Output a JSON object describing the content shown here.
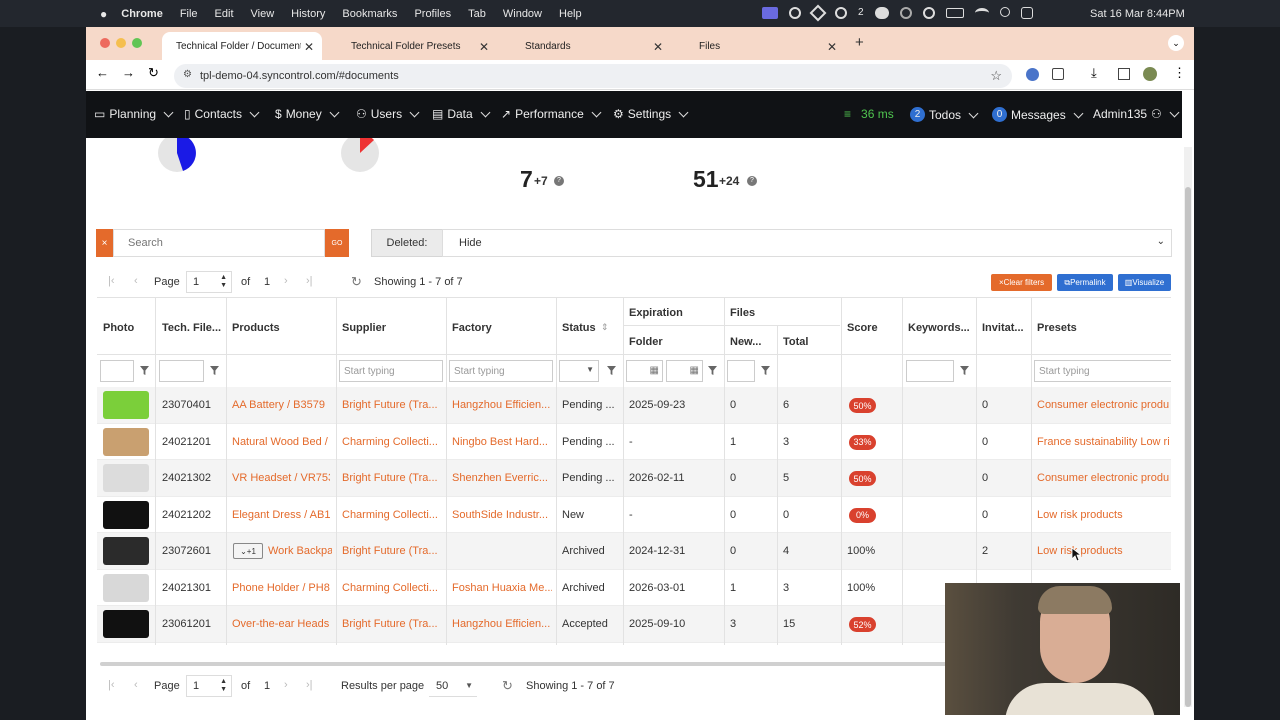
{
  "menubar": {
    "apple": "",
    "app": "Chrome",
    "items": [
      "File",
      "Edit",
      "View",
      "History",
      "Bookmarks",
      "Profiles",
      "Tab",
      "Window",
      "Help"
    ],
    "badge2": "2",
    "datetime": "Sat 16 Mar  8:44PM"
  },
  "tabs": [
    {
      "label": "Technical Folder / Documents"
    },
    {
      "label": "Technical Folder Presets"
    },
    {
      "label": "Standards"
    },
    {
      "label": "Files"
    }
  ],
  "address": {
    "url": "tpl-demo-04.syncontrol.com/#documents"
  },
  "nav": {
    "items": [
      "Planning",
      "Contacts",
      "Money",
      "Users",
      "Data",
      "Performance",
      "Settings"
    ],
    "latency": "36 ms",
    "todos_count": "2",
    "todos_label": "Todos",
    "messages_count": "0",
    "messages_label": "Messages",
    "user": "Admin135"
  },
  "stats": {
    "a_value": "7",
    "a_delta": "+7",
    "b_value": "51",
    "b_delta": "+24"
  },
  "search": {
    "placeholder": "Search",
    "clear": "×",
    "go": "GO"
  },
  "deleted": {
    "label": "Deleted:",
    "value": "Hide"
  },
  "pager_top": {
    "page_label": "Page",
    "page": "1",
    "of": "of",
    "total": "1",
    "showing": "Showing 1 - 7 of 7"
  },
  "actions": {
    "clear": "Clear filters",
    "permalink": "Permalink",
    "visualize": "Visualize"
  },
  "columns": {
    "photo": "Photo",
    "tech": "Tech. File...",
    "products": "Products",
    "supplier": "Supplier",
    "factory": "Factory",
    "status": "Status",
    "expiration": "Expiration",
    "folder": "Folder",
    "files": "Files",
    "new": "New...",
    "total": "Total",
    "score": "Score",
    "keywords": "Keywords...",
    "invit": "Invitat...",
    "presets": "Presets"
  },
  "filters": {
    "start_typing": "Start typing"
  },
  "rows": [
    {
      "tech": "23070401",
      "product": "AA Battery / B3579",
      "supplier": "Bright Future (Tra...",
      "factory": "Hangzhou Efficien...",
      "status": "Pending ...",
      "folder": "2025-09-23",
      "new": "0",
      "total": "6",
      "score": "50%",
      "score_badge": true,
      "invit": "0",
      "preset": "Consumer electronic produ",
      "photo": "battery-icon"
    },
    {
      "tech": "24021201",
      "product": "Natural Wood Bed /",
      "supplier": "Charming Collecti...",
      "factory": "Ningbo Best Hard...",
      "status": "Pending ...",
      "folder": "-",
      "new": "1",
      "total": "3",
      "score": "33%",
      "score_badge": true,
      "invit": "0",
      "preset": "France sustainability Low ri",
      "photo": "bed-icon"
    },
    {
      "tech": "24021302",
      "product": "VR Headset / VR753",
      "supplier": "Bright Future (Tra...",
      "factory": "Shenzhen Everric...",
      "status": "Pending ...",
      "folder": "2026-02-11",
      "new": "0",
      "total": "5",
      "score": "50%",
      "score_badge": true,
      "invit": "0",
      "preset": "Consumer electronic produ",
      "photo": "vr-headset-icon"
    },
    {
      "tech": "24021202",
      "product": "Elegant Dress / AB1‹",
      "supplier": "Charming Collecti...",
      "factory": "SouthSide Industr...",
      "status": "New",
      "folder": "-",
      "new": "0",
      "total": "0",
      "score": "0%",
      "score_badge": true,
      "invit": "0",
      "preset": "Low risk products",
      "photo": "dress-icon"
    },
    {
      "tech": "23072601",
      "product": "Work Backpa",
      "product_tag": "+1",
      "supplier": "Bright Future (Tra...",
      "factory": "",
      "status": "Archived",
      "folder": "2024-12-31",
      "new": "0",
      "total": "4",
      "score": "100%",
      "score_badge": false,
      "invit": "2",
      "preset": "Low risk products",
      "photo": "backpack-icon"
    },
    {
      "tech": "24021301",
      "product": "Phone Holder / PH8(",
      "supplier": "Charming Collecti...",
      "factory": "Foshan Huaxia Me...",
      "status": "Archived",
      "folder": "2026-03-01",
      "new": "1",
      "total": "3",
      "score": "100%",
      "score_badge": false,
      "invit": "0",
      "preset": "Low risk products",
      "photo": "phone-holder-icon"
    },
    {
      "tech": "23061201",
      "product": "Over-the-ear Heads",
      "supplier": "Bright Future (Tra...",
      "factory": "Hangzhou Efficien...",
      "status": "Accepted",
      "folder": "2025-09-10",
      "new": "3",
      "total": "15",
      "score": "52%",
      "score_badge": true,
      "invit": "",
      "preset": "",
      "photo": "headphones-icon"
    }
  ],
  "pager_bottom": {
    "page_label": "Page",
    "page": "1",
    "of": "of",
    "total": "1",
    "rpp_label": "Results per page",
    "rpp": "50",
    "showing": "Showing 1 - 7 of 7"
  },
  "colors": {
    "orange": "#e46a2b",
    "navbar": "#101215",
    "tabstrip": "#f6d9c9",
    "badge": "#d9412e",
    "blue": "#2f6fd1"
  }
}
